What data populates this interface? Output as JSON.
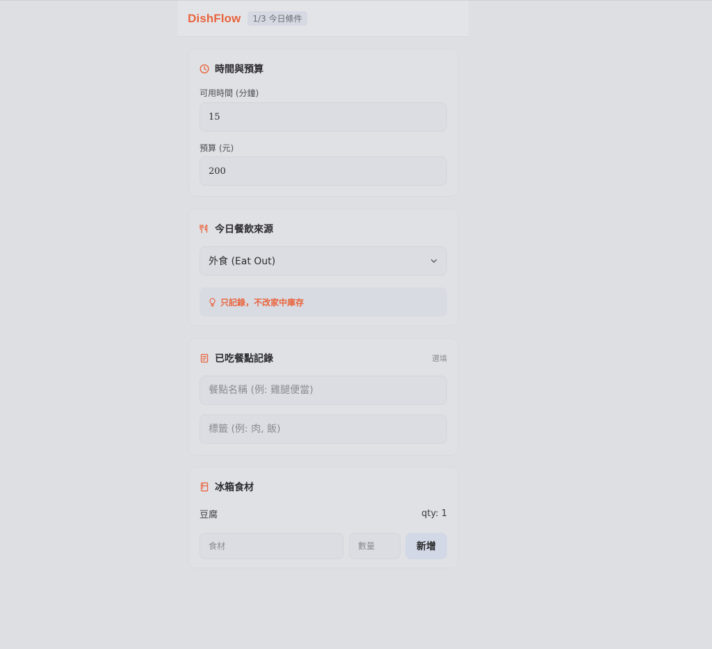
{
  "header": {
    "brand": "DishFlow",
    "step": "1/3 今日條件"
  },
  "time_budget": {
    "title": "時間與預算",
    "time_label": "可用時間 (分鐘)",
    "time_value": "15",
    "budget_label": "預算 (元)",
    "budget_value": "200"
  },
  "meal_source": {
    "title": "今日餐飲來源",
    "selected": "外食 (Eat Out)",
    "note": "只記錄，不改家中庫存"
  },
  "eaten": {
    "title": "已吃餐點記錄",
    "optional": "選填",
    "name_placeholder": "餐點名稱 (例: 雞腿便當)",
    "tags_placeholder": "標籤 (例: 肉, 飯)"
  },
  "fridge": {
    "title": "冰箱食材",
    "items": [
      {
        "name": "豆腐",
        "qty": "qty: 1"
      }
    ],
    "ingredient_placeholder": "食材",
    "qty_placeholder": "數量",
    "add_label": "新增"
  },
  "colors": {
    "accent": "#e8643c",
    "background": "#dedfe3"
  },
  "icons": {
    "time": "clock-icon",
    "meal": "utensils-icon",
    "note": "lightbulb-icon",
    "eaten": "receipt-icon",
    "fridge": "fridge-icon",
    "select": "chevron-down-icon"
  }
}
